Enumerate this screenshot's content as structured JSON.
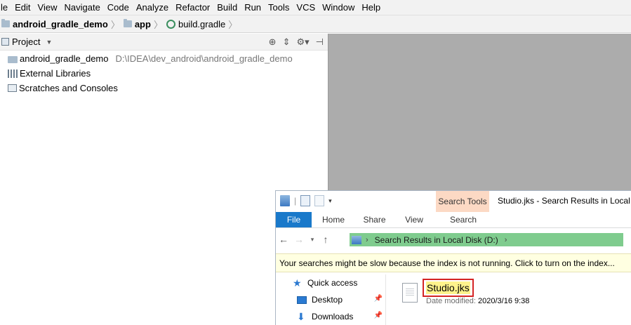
{
  "ide": {
    "menu": [
      "le",
      "Edit",
      "View",
      "Navigate",
      "Code",
      "Analyze",
      "Refactor",
      "Build",
      "Run",
      "Tools",
      "VCS",
      "Window",
      "Help"
    ],
    "breadcrumbs": {
      "project": "android_gradle_demo",
      "module": "app",
      "file": "build.gradle"
    },
    "tool_window": {
      "title": "Project"
    },
    "tree": [
      {
        "label": "android_gradle_demo",
        "path": "D:\\IDEA\\dev_android\\android_gradle_demo",
        "icon": "module-folder-icon"
      },
      {
        "label": "External Libraries",
        "path": "",
        "icon": "libraries-icon"
      },
      {
        "label": "Scratches and Consoles",
        "path": "",
        "icon": "scratches-icon"
      }
    ]
  },
  "explorer": {
    "window_title": "Studio.jks - Search Results in Local D",
    "context_tab_group": "Search Tools",
    "ribbon_tabs": {
      "file": "File",
      "home": "Home",
      "share": "Share",
      "view": "View",
      "search": "Search"
    },
    "address": "Search Results in Local Disk (D:)",
    "infobar": "Your searches might be slow because the index is not running.  Click to turn on the index...",
    "nav": {
      "quick_access": "Quick access",
      "desktop": "Desktop",
      "downloads": "Downloads"
    },
    "result": {
      "name": "Studio.jks",
      "date_label": "Date modified:",
      "date_value": "2020/3/16 9:38"
    }
  },
  "colors": {
    "file_tab": "#1979ca",
    "search_tools": "#fcd9c4",
    "address_bar": "#7fcc8e",
    "infobar": "#ffffe1",
    "highlight": "#fff38c",
    "annotation_box": "#d42424",
    "editor_bg": "#acacac"
  }
}
